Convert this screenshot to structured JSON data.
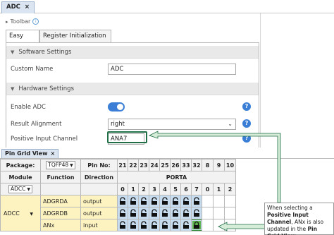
{
  "adc": {
    "tab_label": "ADC",
    "tab_close": "×",
    "toolbar_label": "Toolbar",
    "view_tabs": [
      "Easy View",
      "Register Initialization"
    ],
    "software_section": "Software Settings",
    "hardware_section": "Hardware Settings",
    "custom_name_label": "Custom Name",
    "custom_name_value": "ADC",
    "enable_label": "Enable ADC",
    "enable_value": true,
    "result_alignment_label": "Result Alignment",
    "result_alignment_value": "right",
    "positive_input_label": "Positive Input Channel",
    "positive_input_value": "ANA7",
    "help_glyph": "?"
  },
  "pin_grid": {
    "tab_label": "Pin Grid View",
    "tab_close": "×",
    "package_label": "Package:",
    "package_value": "TQFP48",
    "pin_no_label": "Pin No:",
    "pin_numbers": [
      "21",
      "22",
      "23",
      "24",
      "25",
      "26",
      "33",
      "32",
      "8",
      "9",
      "10"
    ],
    "module_header": "Module",
    "function_header": "Function",
    "direction_header": "Direction",
    "port_label": "PORTA",
    "port_bits": [
      "0",
      "1",
      "2",
      "3",
      "4",
      "5",
      "6",
      "7",
      "0",
      "1",
      "2"
    ],
    "module_filter": "ADCC",
    "module_name": "ADCC",
    "rows": [
      {
        "function": "ADGRDA",
        "direction": "output"
      },
      {
        "function": "ADGRDB",
        "direction": "output"
      },
      {
        "function": "ANx",
        "direction": "input"
      }
    ]
  },
  "callout": {
    "line1": "When selecting a",
    "bold1": "Positive Input Channel",
    "line2": ", ANx is also updated in the",
    "bold2": "Pin Grid View"
  },
  "colors": {
    "accent_blue": "#3a7fd5",
    "highlight_green": "#1f6e45",
    "pin_blue": "#c8dcef",
    "module_yellow": "#fdf3c0"
  }
}
